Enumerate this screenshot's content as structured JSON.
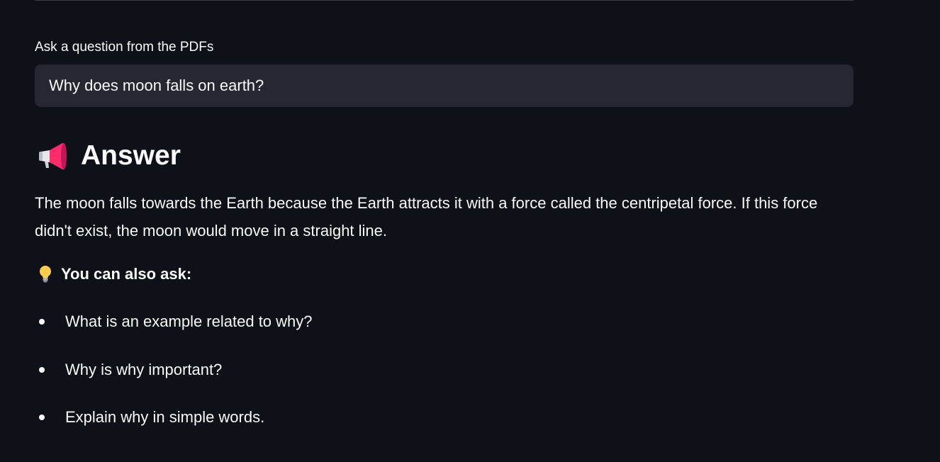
{
  "question": {
    "label": "Ask a question from the PDFs",
    "value": "Why does moon falls on earth?"
  },
  "answer": {
    "heading_icon": "megaphone-icon",
    "heading": "Answer",
    "text": "The moon falls towards the Earth because the Earth attracts it with a force called the centripetal force. If this force didn't exist, the moon would move in a straight line."
  },
  "suggestions": {
    "heading_icon": "light-bulb-icon",
    "heading": "You can also ask:",
    "items": [
      {
        "label": "What is an example related to why?"
      },
      {
        "label": "Why is why important?"
      },
      {
        "label": "Explain why in simple words."
      }
    ]
  },
  "colors": {
    "background": "#0e1117",
    "input_background": "#262730",
    "text": "#fafafa",
    "icon_accent": "#ff2b6a"
  }
}
